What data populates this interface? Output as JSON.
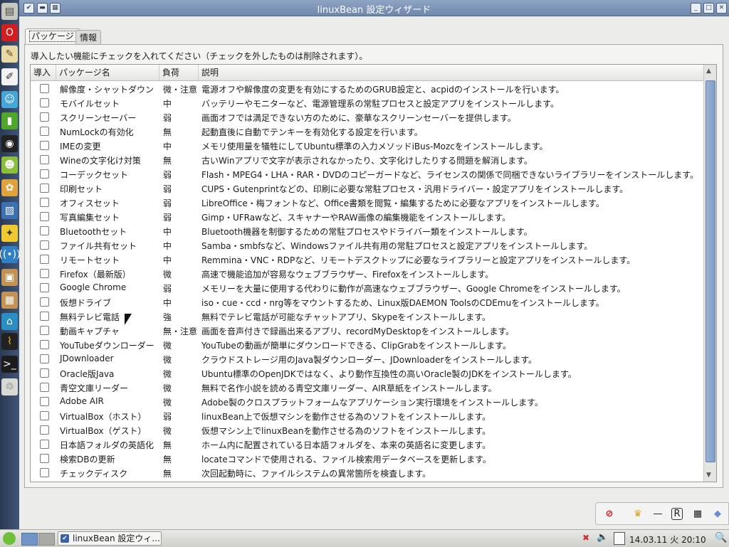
{
  "window": {
    "title": "linuxBean 設定ウィザード"
  },
  "tabs": [
    {
      "label": "パッケージ"
    },
    {
      "label": "情報"
    }
  ],
  "instruction": "導入したい機能にチェックを入れてください（チェックを外したものは削除されます）。",
  "columns": {
    "install": "導入",
    "package": "パッケージ名",
    "load": "負荷",
    "description": "説明"
  },
  "packages": [
    {
      "name": "解像度・シャットダウン",
      "load": "微・注意",
      "desc": "電源オフや解像度の変更を有効にするためのGRUB設定と、acpidのインストールを行います。"
    },
    {
      "name": "モバイルセット",
      "load": "中",
      "desc": "バッテリーやモニターなど、電源管理系の常駐プロセスと設定アプリをインストールします。"
    },
    {
      "name": "スクリーンセーバー",
      "load": "弱",
      "desc": "画面オフでは満足できない方のために、豪華なスクリーンセーバーを提供します。"
    },
    {
      "name": "NumLockの有効化",
      "load": "無",
      "desc": "起動直後に自動でテンキーを有効化する設定を行います。"
    },
    {
      "name": "IMEの変更",
      "load": "中",
      "desc": "メモリ使用量を犠牲にしてUbuntu標準の入力メソッドiBus-Mozcをインストールします。"
    },
    {
      "name": "Wineの文字化け対策",
      "load": "無",
      "desc": "古いWinアプリで文字が表示されなかったり、文字化けしたりする問題を解消します。"
    },
    {
      "name": "コーデックセット",
      "load": "弱",
      "desc": "Flash・MPEG4・LHA・RAR・DVDのコピーガードなど、ライセンスの関係で同梱できないライブラリーをインストールします。"
    },
    {
      "name": "印刷セット",
      "load": "弱",
      "desc": "CUPS・Gutenprintなどの、印刷に必要な常駐プロセス・汎用ドライバー・設定アプリをインストールします。"
    },
    {
      "name": "オフィスセット",
      "load": "弱",
      "desc": "LibreOffice・梅フォントなど、Office書類を閲覧・編集するために必要なアプリをインストールします。"
    },
    {
      "name": "写真編集セット",
      "load": "弱",
      "desc": "Gimp・UFRawなど、スキャナーやRAW画像の編集機能をインストールします。"
    },
    {
      "name": "Bluetoothセット",
      "load": "中",
      "desc": "Bluetooth機器を制御するための常駐プロセスやドライバー類をインストールします。"
    },
    {
      "name": "ファイル共有セット",
      "load": "中",
      "desc": "Samba・smbfsなど、Windowsファイル共有用の常駐プロセスと設定アプリをインストールします。"
    },
    {
      "name": "リモートセット",
      "load": "中",
      "desc": "Remmina・VNC・RDPなど、リモートデスクトップに必要なライブラリーと設定アプリをインストールします。"
    },
    {
      "name": "Firefox（最新版）",
      "load": "微",
      "desc": "高速で機能追加が容易なウェブブラウザー、Firefoxをインストールします。"
    },
    {
      "name": "Google Chrome",
      "load": "弱",
      "desc": "メモリーを大量に使用する代わりに動作が高速なウェブブラウザー、Google Chromeをインストールします。"
    },
    {
      "name": "仮想ドライブ",
      "load": "中",
      "desc": "iso・cue・ccd・nrg等をマウントするため、Linux版DAEMON ToolsのCDEmuをインストールします。"
    },
    {
      "name": "無料テレビ電話",
      "load": "強",
      "desc": "無料でテレビ電話が可能なチャットアプリ、Skypeをインストールします。"
    },
    {
      "name": "動画キャプチャ",
      "load": "無・注意",
      "desc": "画面を音声付きで録画出来るアプリ、recordMyDesktopをインストールします。"
    },
    {
      "name": "YouTubeダウンローダー",
      "load": "微",
      "desc": "YouTubeの動画が簡単にダウンロードできる、ClipGrabをインストールします。"
    },
    {
      "name": "JDownloader",
      "load": "微",
      "desc": "クラウドストレージ用のJava製ダウンローダー、JDownloaderをインストールします。"
    },
    {
      "name": "Oracle版Java",
      "load": "微",
      "desc": "Ubuntu標準のOpenJDKではなく、より動作互換性の高いOracle製のJDKをインストールします。"
    },
    {
      "name": "青空文庫リーダー",
      "load": "微",
      "desc": "無料で名作小説を読める青空文庫リーダー、AIR草紙をインストールします。"
    },
    {
      "name": "Adobe AIR",
      "load": "微",
      "desc": "Adobe製のクロスプラットフォームなアプリケーション実行環境をインストールします。"
    },
    {
      "name": "VirtualBox（ホスト）",
      "load": "弱",
      "desc": "linuxBean上で仮想マシンを動作させる為のソフトをインストールします。"
    },
    {
      "name": "VirtualBox（ゲスト）",
      "load": "微",
      "desc": "仮想マシン上でlinuxBeanを動作させる為のソフトをインストールします。"
    },
    {
      "name": "日本語フォルダの英語化",
      "load": "無",
      "desc": "ホーム内に配置されている日本語フォルダを、本来の英語名に変更します。"
    },
    {
      "name": "検索DBの更新",
      "load": "無",
      "desc": "locateコマンドで使用される、ファイル検索用データベースを更新します。"
    },
    {
      "name": "チェックディスク",
      "load": "無",
      "desc": "次回起動時に、ファイルシステムの異常箇所を検査します。"
    }
  ],
  "taskbar": {
    "task_label": "linuxBean 設定ウィ...",
    "clock": "14.03.11 火 20:10"
  }
}
